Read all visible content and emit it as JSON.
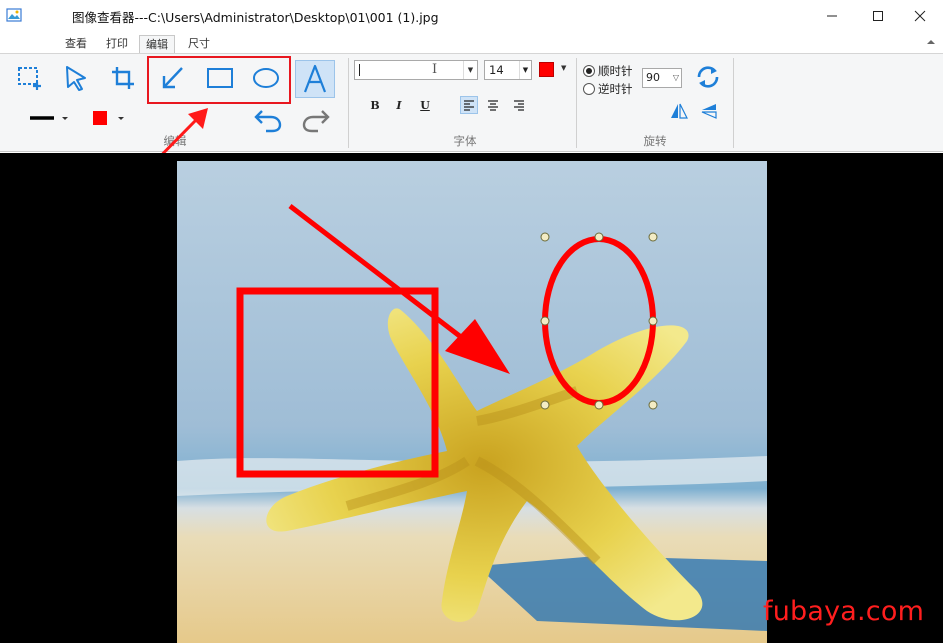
{
  "window": {
    "title": "图像查看器---C:\\Users\\Administrator\\Desktop\\01\\001 (1).jpg",
    "icon": "image-viewer-icon",
    "controls": [
      "minimize-icon",
      "maximize-icon",
      "close-icon"
    ]
  },
  "ribbon": {
    "tabs": [
      {
        "label": "查看",
        "active": false
      },
      {
        "label": "打印",
        "active": false
      },
      {
        "label": "编辑",
        "active": true
      },
      {
        "label": "尺寸",
        "active": false
      }
    ],
    "edit_group": {
      "label": "编辑",
      "tools": [
        "select-region-icon",
        "pointer-icon",
        "crop-icon",
        "arrow-tool-icon",
        "rectangle-tool-icon",
        "ellipse-tool-icon",
        "text-tool-icon",
        "line-width-icon",
        "color-icon",
        "undo-icon",
        "redo-icon"
      ],
      "active_tool": "text-tool-icon",
      "line_color": "#ff0000"
    },
    "font_group": {
      "label": "字体",
      "font_name": "",
      "font_size": "14",
      "font_color": "#ff0000",
      "format_buttons": [
        "B",
        "I",
        "U"
      ],
      "align_buttons": [
        "align-left-icon",
        "align-center-icon",
        "align-right-icon"
      ]
    },
    "rotate_group": {
      "label": "旋转",
      "clockwise_label": "顺时针",
      "counterclockwise_label": "逆时针",
      "selected": "clockwise",
      "angle": "90",
      "buttons": [
        "rotate-icon",
        "flip-horizontal-icon",
        "flip-vertical-icon"
      ]
    }
  },
  "canvas": {
    "background": "#000000",
    "annotation_color": "#ff0000",
    "annotations": [
      "arrow",
      "rectangle",
      "ellipse"
    ],
    "selected_annotation": "ellipse"
  },
  "watermark": "fubaya.com"
}
